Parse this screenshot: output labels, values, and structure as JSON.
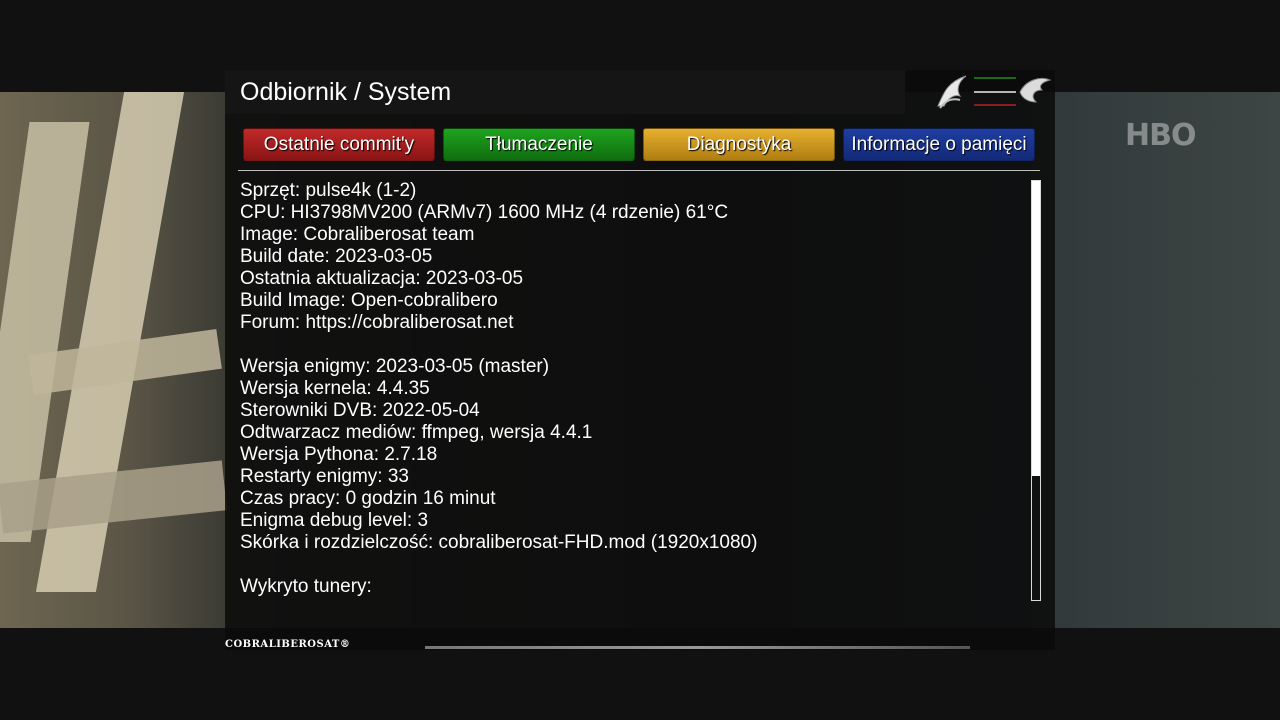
{
  "screen": {
    "title": "Odbiornik / System",
    "channel_logo": "HBO",
    "brand_footer": "COBRALIBEROSAT®"
  },
  "buttons": {
    "red": "Ostatnie commit'y",
    "green": "Tłumaczenie",
    "yellow": "Diagnostyka",
    "blue": "Informacje o pamięci"
  },
  "colors": {
    "red": "#b01f1f",
    "green": "#178a17",
    "yellow": "#d49a20",
    "blue": "#1a3590"
  },
  "info_lines": [
    "Sprzęt: pulse4k (1-2)",
    "CPU: HI3798MV200 (ARMv7) 1600 MHz (4 rdzenie) 61°C",
    "Image: Cobraliberosat team",
    "Build date: 2023-03-05",
    "Ostatnia aktualizacja: 2023-03-05",
    "Build Image: Open-cobralibero",
    "Forum: https://cobraliberosat.net",
    "",
    "Wersja enigmy: 2023-03-05 (master)",
    "Wersja kernela: 4.4.35",
    "Sterowniki DVB: 2022-05-04",
    "Odtwarzacz mediów: ffmpeg, wersja 4.4.1",
    "Wersja Pythona: 2.7.18",
    "Restarty enigmy: 33",
    "Czas pracy: 0 godzin 16 minut",
    "Enigma debug level: 3",
    "Skórka i rozdzielczość: cobraliberosat-FHD.mod (1920x1080)",
    "",
    "Wykryto tunery:"
  ],
  "scrollbar": {
    "position_fraction": 0.0,
    "visible_fraction": 0.7
  },
  "icons": {
    "logo": "cobra-dragon-logo-icon"
  }
}
